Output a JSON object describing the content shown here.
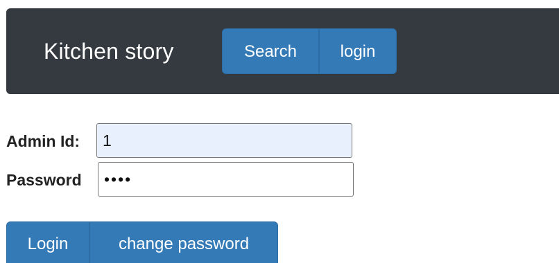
{
  "navbar": {
    "brand": "Kitchen story",
    "search_label": "Search",
    "login_label": "login"
  },
  "form": {
    "admin_id": {
      "label": "Admin Id:",
      "value": "1"
    },
    "password": {
      "label": "Password",
      "value": "••••"
    },
    "login_label": "Login",
    "change_password_label": "change password"
  },
  "colors": {
    "navbar_bg": "#343a40",
    "button_bg": "#337ab7",
    "autofill_bg": "#e8f0fe"
  }
}
